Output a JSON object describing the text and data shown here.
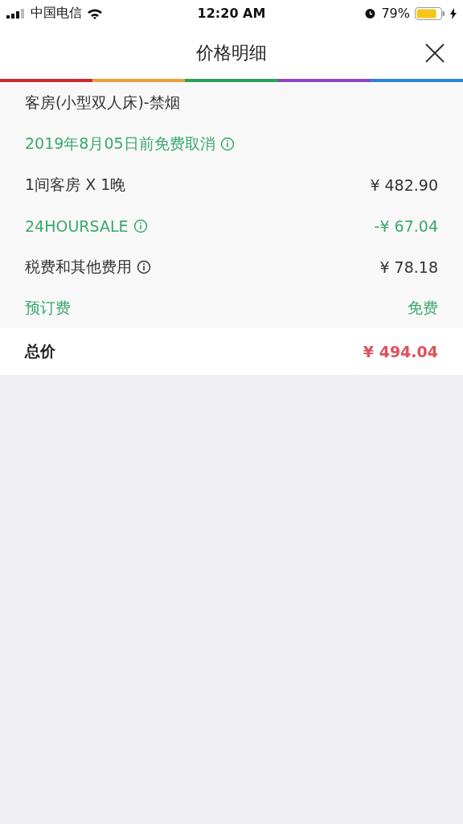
{
  "status_bar": {
    "carrier": "中国电信",
    "time": "12:20 AM",
    "battery": "79%"
  },
  "header": {
    "title": "价格明细"
  },
  "stripe": [
    {
      "color": "#d0282c"
    },
    {
      "color": "#e9a23b"
    },
    {
      "color": "#2e9d5b"
    },
    {
      "color": "#8d44c0"
    },
    {
      "color": "#2a86cf"
    }
  ],
  "lines": [
    {
      "label": "客房(小型双人床)-禁烟",
      "color": "#333333",
      "info": false
    },
    {
      "label": "2019年8月05日前免费取消",
      "color": "#3aa86b",
      "info": true
    },
    {
      "label": "1间客房 X 1晚",
      "value": "¥ 482.90",
      "color": "#333333",
      "info": false
    },
    {
      "label": "24HOURSALE",
      "value": "-¥ 67.04",
      "color": "#3aa86b",
      "info": true
    },
    {
      "label": "税费和其他费用",
      "value": "¥ 78.18",
      "color": "#333333",
      "info": true
    },
    {
      "label": "预订费",
      "value": "免费",
      "color": "#3aa86b",
      "info": false
    }
  ],
  "total": {
    "label": "总价",
    "value": "¥ 494.04"
  }
}
